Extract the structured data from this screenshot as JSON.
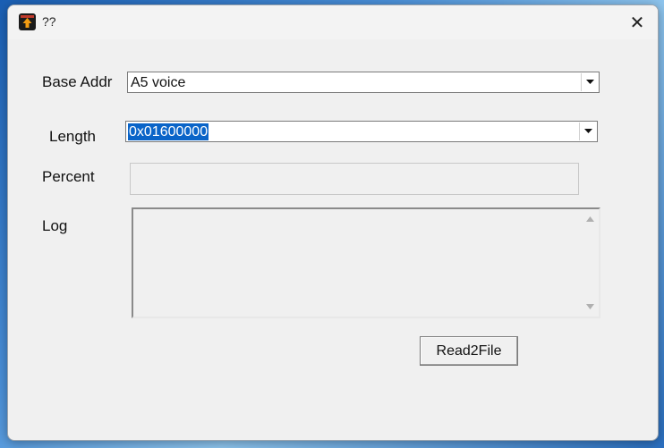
{
  "window": {
    "title": "??",
    "close_glyph": "✕"
  },
  "form": {
    "base_addr_label": "Base Addr",
    "base_addr_value": "A5 voice",
    "length_label": "Length",
    "length_value": "0x01600000",
    "percent_label": "Percent",
    "percent_value": "",
    "log_label": "Log",
    "log_value": ""
  },
  "actions": {
    "read2file_label": "Read2File"
  },
  "icons": {
    "app": "app-icon",
    "close": "close-icon",
    "dropdown": "chevron-down-icon",
    "scroll_up": "scroll-up-arrow-icon",
    "scroll_down": "scroll-down-arrow-icon"
  }
}
